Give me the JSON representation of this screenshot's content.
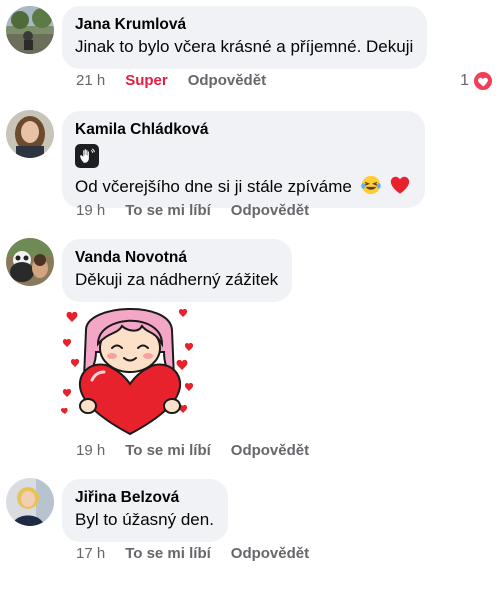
{
  "comments": [
    {
      "author": "Jana Krumlová",
      "text": "Jinak to bylo včera krásné  a příjemné. Dekuji",
      "time": "21 h",
      "like_label": "Super",
      "reply_label": "Odpovědět",
      "reaction_count": "1",
      "reaction_icon": "heart-icon"
    },
    {
      "author": "Kamila Chládková",
      "text": "Od včerejšího dne si ji stále zpíváme",
      "badge_icon": "waving-hand-icon",
      "emojis": [
        "laughing-tears-emoji",
        "red-heart-emoji"
      ],
      "time": "19 h",
      "like_label": "To se mi líbí",
      "reply_label": "Odpovědět"
    },
    {
      "author": "Vanda Novotná",
      "text": "Děkuji za nádherný zážitek",
      "sticker": "girl-holding-heart-sticker",
      "time": "19 h",
      "like_label": "To se mi líbí",
      "reply_label": "Odpovědět"
    },
    {
      "author": "Jiřina Belzová",
      "text": "Byl to úžasný den.",
      "time": "17 h",
      "like_label": "To se mi líbí",
      "reply_label": "Odpovědět"
    }
  ],
  "colors": {
    "bubble_bg": "#f0f2f5",
    "meta_text": "#65676b",
    "super_red": "#e41e3f",
    "heart_badge": "#f33e58"
  }
}
